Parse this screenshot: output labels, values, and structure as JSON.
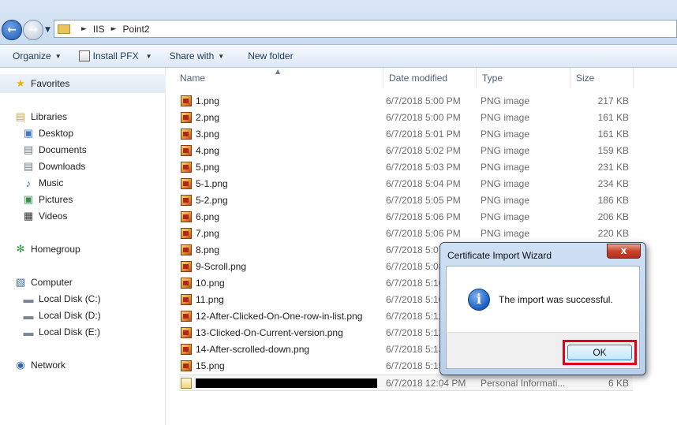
{
  "address": {
    "breadcrumbs": [
      "IIS",
      "Point2"
    ]
  },
  "toolbar": {
    "organize": "Organize",
    "install_pfx": "Install PFX",
    "share_with": "Share with",
    "new_folder": "New folder"
  },
  "nav": {
    "favorites": "Favorites",
    "libraries": "Libraries",
    "library_items": [
      "Desktop",
      "Documents",
      "Downloads",
      "Music",
      "Pictures",
      "Videos"
    ],
    "homegroup": "Homegroup",
    "computer": "Computer",
    "drives": [
      "Local Disk (C:)",
      "Local Disk (D:)",
      "Local Disk (E:)"
    ],
    "network": "Network"
  },
  "columns": {
    "name": "Name",
    "date_modified": "Date modified",
    "type": "Type",
    "size": "Size"
  },
  "files": [
    {
      "name": "1.png",
      "date": "6/7/2018 5:00 PM",
      "type": "PNG image",
      "size": "217 KB"
    },
    {
      "name": "2.png",
      "date": "6/7/2018 5:00 PM",
      "type": "PNG image",
      "size": "161 KB"
    },
    {
      "name": "3.png",
      "date": "6/7/2018 5:01 PM",
      "type": "PNG image",
      "size": "161 KB"
    },
    {
      "name": "4.png",
      "date": "6/7/2018 5:02 PM",
      "type": "PNG image",
      "size": "159 KB"
    },
    {
      "name": "5.png",
      "date": "6/7/2018 5:03 PM",
      "type": "PNG image",
      "size": "231 KB"
    },
    {
      "name": "5-1.png",
      "date": "6/7/2018 5:04 PM",
      "type": "PNG image",
      "size": "234 KB"
    },
    {
      "name": "5-2.png",
      "date": "6/7/2018 5:05 PM",
      "type": "PNG image",
      "size": "186 KB"
    },
    {
      "name": "6.png",
      "date": "6/7/2018 5:06 PM",
      "type": "PNG image",
      "size": "206 KB"
    },
    {
      "name": "7.png",
      "date": "6/7/2018 5:06 PM",
      "type": "PNG image",
      "size": "220 KB"
    },
    {
      "name": "8.png",
      "date": "6/7/2018 5:07",
      "type": "",
      "size": ""
    },
    {
      "name": "9-Scroll.png",
      "date": "6/7/2018 5:08",
      "type": "",
      "size": ""
    },
    {
      "name": "10.png",
      "date": "6/7/2018 5:10",
      "type": "",
      "size": ""
    },
    {
      "name": "11.png",
      "date": "6/7/2018 5:10",
      "type": "",
      "size": ""
    },
    {
      "name": "12-After-Clicked-On-One-row-in-list.png",
      "date": "6/7/2018 5:12",
      "type": "",
      "size": ""
    },
    {
      "name": "13-Clicked-On-Current-version.png",
      "date": "6/7/2018 5:12",
      "type": "",
      "size": ""
    },
    {
      "name": "14-After-scrolled-down.png",
      "date": "6/7/2018 5:13",
      "type": "",
      "size": ""
    },
    {
      "name": "15.png",
      "date": "6/7/2018 5:15",
      "type": "",
      "size": ""
    }
  ],
  "selected_file": {
    "date": "6/7/2018 12:04 PM",
    "type": "Personal Informati...",
    "size": "6 KB"
  },
  "dialog": {
    "title": "Certificate Import Wizard",
    "close": "x",
    "message": "The import was successful.",
    "ok": "OK"
  },
  "icons": {
    "back": "back-arrow-icon",
    "forward": "forward-arrow-icon",
    "info": "info-icon",
    "png": "png-file-icon",
    "pfx": "certificate-file-icon"
  }
}
